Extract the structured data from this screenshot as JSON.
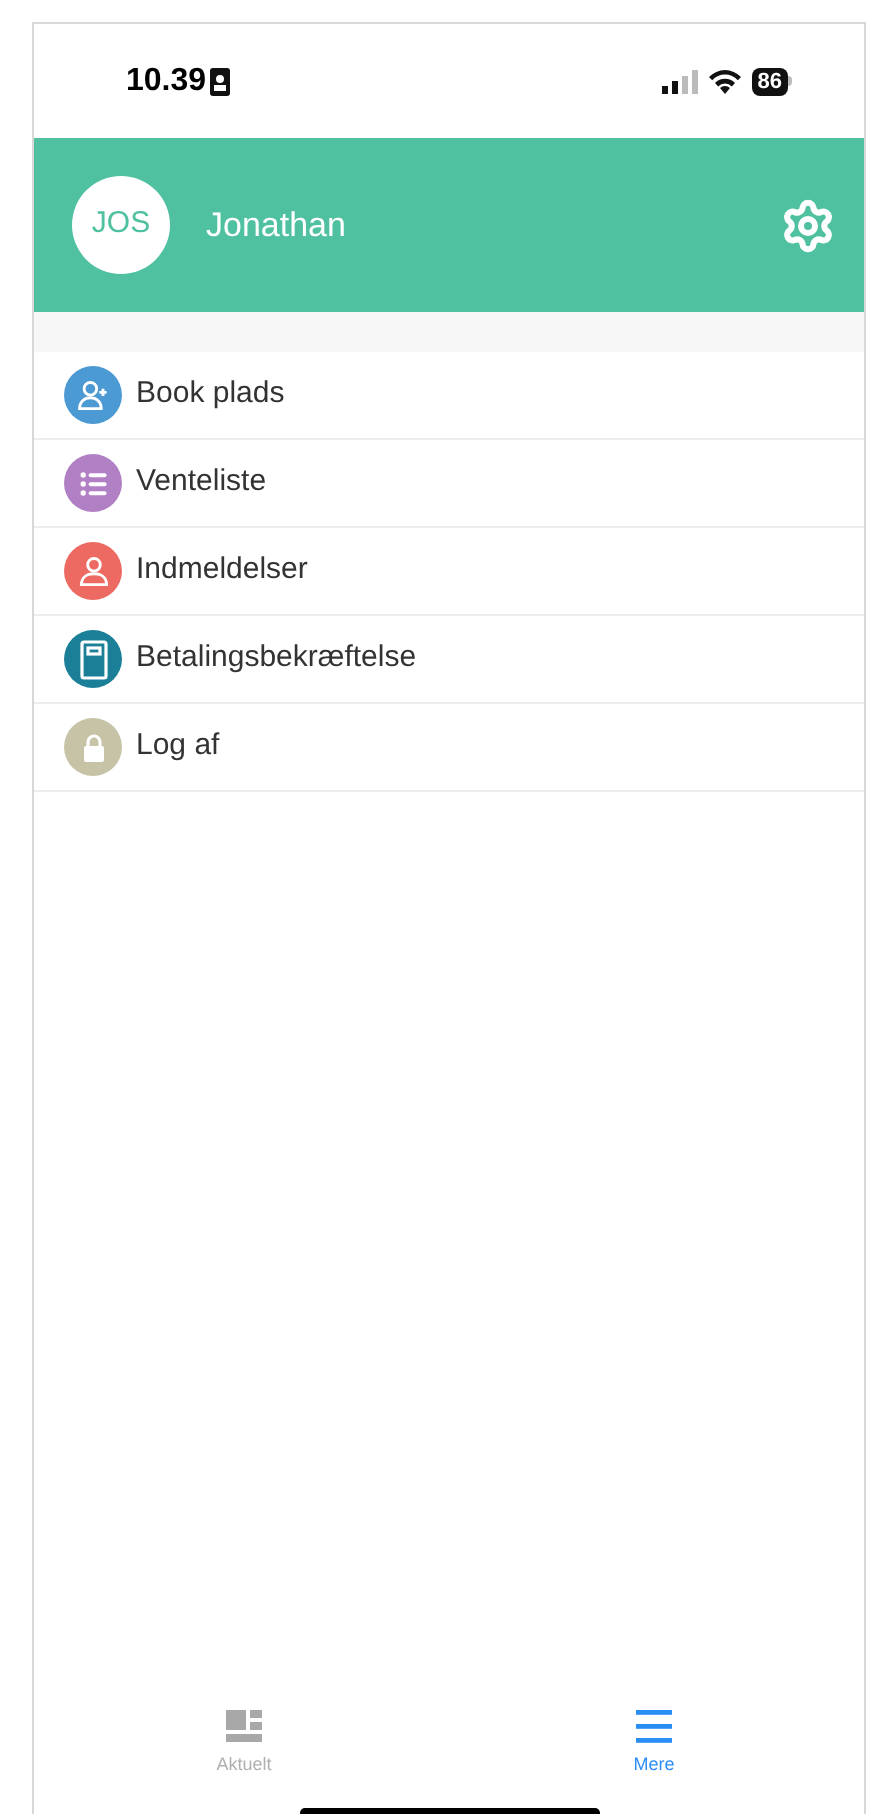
{
  "status_bar": {
    "time": "10.39",
    "battery": "86"
  },
  "header": {
    "initials": "JOS",
    "name": "Jonathan"
  },
  "menu": [
    {
      "kind": "person-add",
      "label": "Book plads",
      "color": "#4b9ad4"
    },
    {
      "kind": "list",
      "label": "Venteliste",
      "color": "#b07fc4"
    },
    {
      "kind": "person",
      "label": "Indmeldelser",
      "color": "#ec6a62"
    },
    {
      "kind": "notebook",
      "label": "Betalingsbekræftelse",
      "color": "#1c7f98"
    },
    {
      "kind": "lock",
      "label": "Log af",
      "color": "#c6c3a6"
    }
  ],
  "tabs": [
    {
      "kind": "dashboard",
      "label": "Aktuelt",
      "selected": false
    },
    {
      "kind": "menu",
      "label": "Mere",
      "selected": true
    }
  ]
}
